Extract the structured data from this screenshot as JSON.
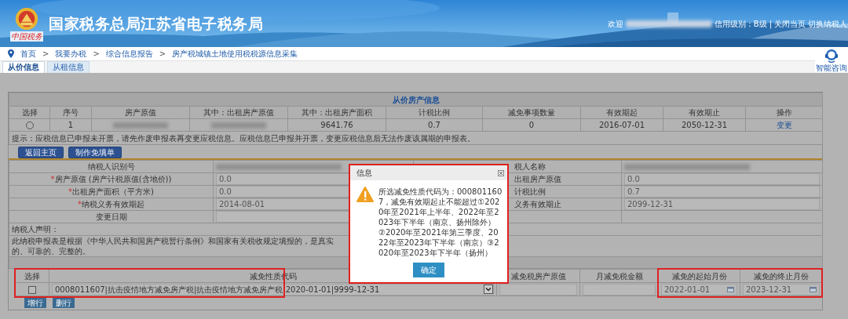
{
  "header": {
    "logo_text": "中国税务",
    "title": "国家税务总局江苏省电子税务局",
    "welcome": "欢迎",
    "user_redacted": true,
    "credit": "信用级别：B级",
    "separator": "|",
    "links": [
      "关闭当页",
      "切换纳税人"
    ]
  },
  "breadcrumb": [
    {
      "kind": "link",
      "label": "首页"
    },
    {
      "kind": "separator",
      "label": ">"
    },
    {
      "kind": "link",
      "label": "我要办税"
    },
    {
      "kind": "separator",
      "label": ">"
    },
    {
      "kind": "link",
      "label": "综合信息报告"
    },
    {
      "kind": "separator",
      "label": ">"
    },
    {
      "kind": "link",
      "label": "房产税城镇土地使用税税源信息采集"
    }
  ],
  "assistant": {
    "label": "智能咨询"
  },
  "tabs": [
    {
      "label": "从价信息",
      "selected": true
    },
    {
      "label": "从租信息",
      "selected": false
    }
  ],
  "property_table": {
    "title": "从价房产信息",
    "columns": [
      "选择",
      "序号",
      "房产原值",
      "其中：出租房产原值",
      "其中：出租房产面积",
      "计税比例",
      "减免事项数量",
      "有效期起",
      "有效期止",
      "操作"
    ],
    "rows": [
      {
        "cells": [
          {
            "kind": "radio",
            "selected": false
          },
          {
            "kind": "text",
            "text": "1"
          },
          {
            "kind": "redacted"
          },
          {
            "kind": "redacted"
          },
          {
            "kind": "text",
            "text": "9641.76"
          },
          {
            "kind": "text",
            "text": "0.7"
          },
          {
            "kind": "text",
            "text": "0"
          },
          {
            "kind": "text",
            "text": "2016-07-01"
          },
          {
            "kind": "text",
            "text": "2050-12-31"
          },
          {
            "kind": "link",
            "text": "变更"
          }
        ]
      }
    ],
    "tip": "提示：应税信息已申报未开票，请先作废申报表再变更应税信息。应税信息已申报并开票，变更应税信息后无法作废该属期的申报表。"
  },
  "actions": [
    "返回主页",
    "制作免填单"
  ],
  "form": {
    "rows": [
      {
        "label": "纳税人识别号",
        "redacted": true,
        "right_label": "税人名称",
        "right_redacted": true
      },
      {
        "mark": "*",
        "label": "房产原值 (房产计税原值(含地价))",
        "value": "0.0",
        "right_label": "出租房产原值",
        "right_value": "0.0"
      },
      {
        "mark": "*",
        "label": "出租房产面积（平方米)",
        "value": "0.0",
        "right_label": "计税比例",
        "right_value": "0.7"
      },
      {
        "mark": "*",
        "label": "纳税义务有效期起",
        "value": "2014-08-01",
        "right_label": "义务有效期止",
        "right_value": "2099-12-31"
      },
      {
        "label": "变更日期"
      }
    ],
    "declaration_title": "纳税人声明：",
    "declaration": "此纳税申报表是根据《中华人民共和国房产税暂行条例》和国家有关税收规定填报的，是真实的、可靠的、完整的。"
  },
  "relief_table": {
    "columns": [
      "选择",
      "减免性质代码",
      "减免税房产原值",
      "月减免税金额",
      "减免的起始月份",
      "减免的终止月份"
    ],
    "rows": [
      {
        "checked": false,
        "code": "0008011607|抗击疫情地方减免房产税|抗击疫情地方减免房产税|2020-01-01|9999-12-31",
        "start": "2022-01-01",
        "end": "2023-12-31"
      }
    ],
    "buttons": [
      "增行",
      "删行"
    ]
  },
  "dialog": {
    "title": "信息",
    "message": "所选减免性质代码为：0008011607，减免有效期起止不能超过①2020年至2021年上半年、2022年至2023年下半年（南京、扬州除外）②2020年至2021年第三季度、2022年至2023年下半年（南京）③2020年至2023年下半年（扬州）",
    "button": "确定"
  }
}
